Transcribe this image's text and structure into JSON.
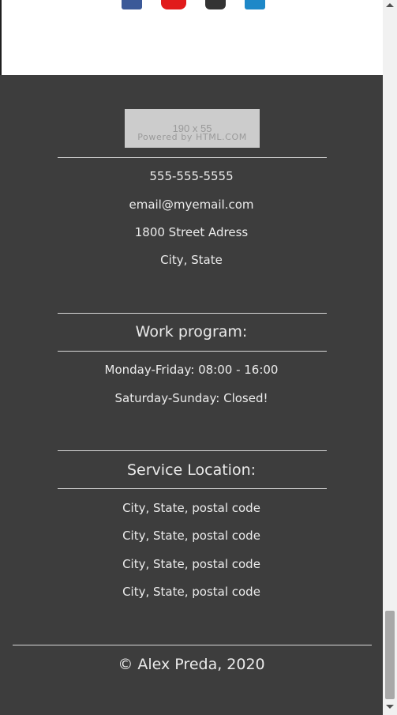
{
  "social": {
    "icons": [
      "facebook-icon",
      "youtube-icon",
      "github-icon",
      "linkedin-icon"
    ],
    "colors": {
      "facebook": "#3b5998",
      "youtube": "#e11b1b",
      "github": "#333333",
      "linkedin": "#1e88c8"
    }
  },
  "logo": {
    "size_text": "190 x 55",
    "powered_text": "Powered by HTML.COM"
  },
  "contact": {
    "phone": "555-555-5555",
    "email": "email@myemail.com",
    "address": "1800 Street Adress",
    "city_state": "City, State"
  },
  "work_program": {
    "title": "Work program:",
    "weekdays": "Monday-Friday: 08:00 - 16:00",
    "weekend": "Saturday-Sunday: Closed!"
  },
  "service_location": {
    "title": "Service Location:",
    "locations": [
      "City, State, postal code",
      "City, State, postal code",
      "City, State, postal code",
      "City, State, postal code"
    ]
  },
  "footer": {
    "copyright": "© Alex Preda, 2020"
  },
  "colors": {
    "footer_bg": "#3d3d3d",
    "text": "#ececec",
    "divider": "#d8d8d8"
  }
}
